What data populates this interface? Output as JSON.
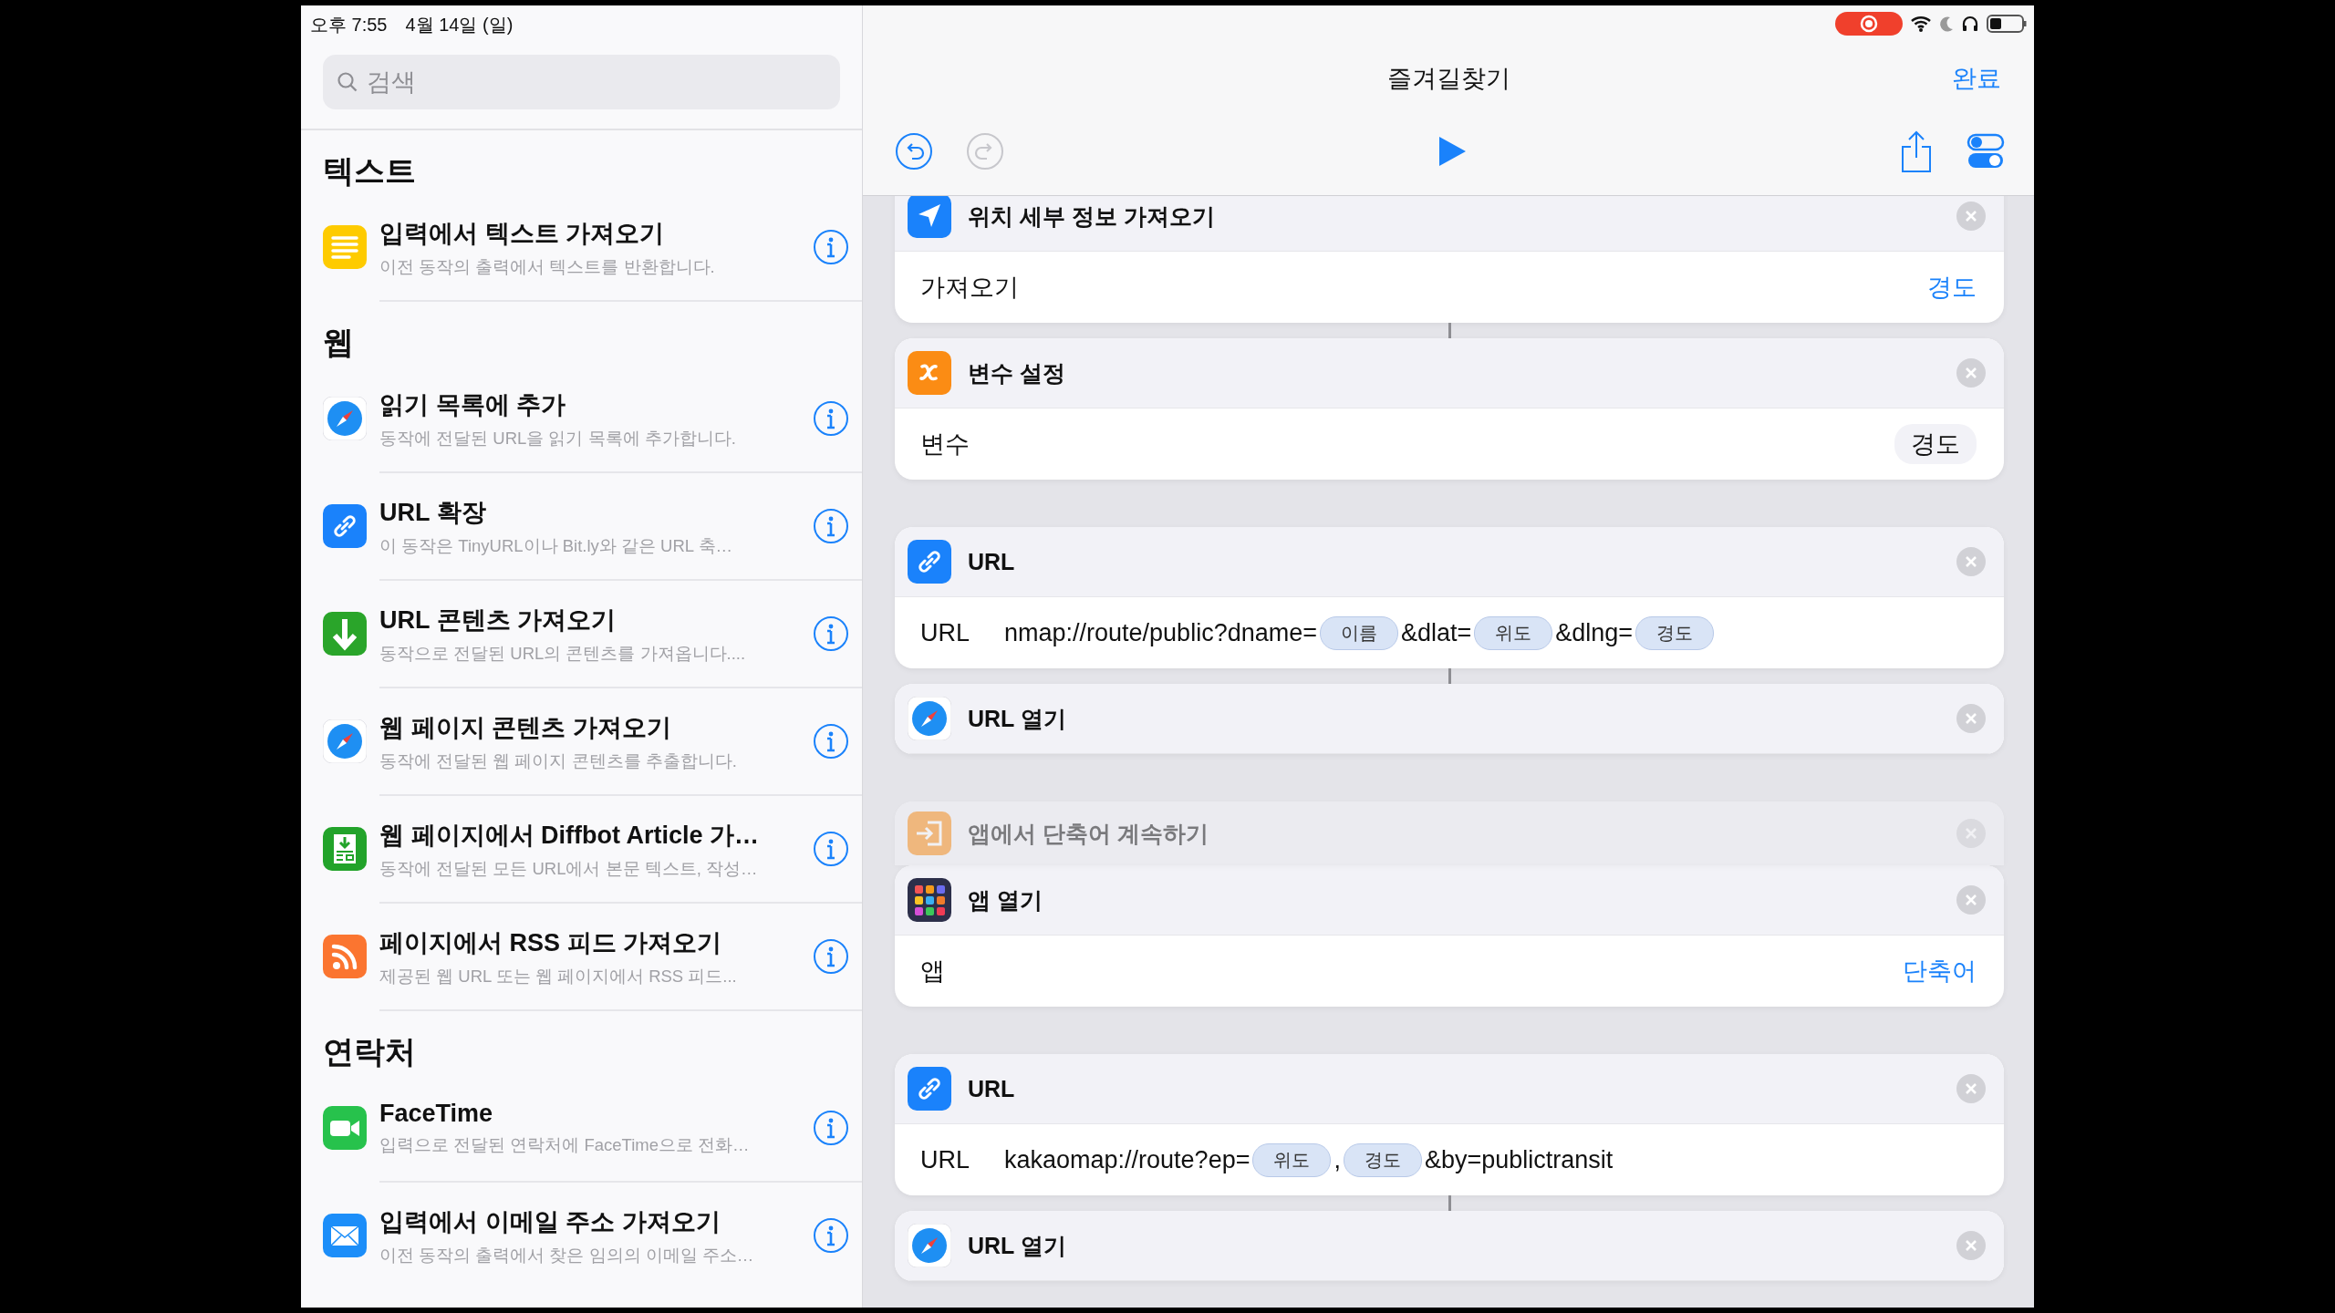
{
  "status_bar": {
    "time": "오후 7:55",
    "date": "4월 14일 (일)",
    "recording": true
  },
  "sidebar": {
    "search": {
      "placeholder": "검색"
    },
    "sections": [
      {
        "title": "텍스트",
        "items": [
          {
            "kind": "text",
            "title": "입력에서 텍스트 가져오기",
            "subtitle": "이전 동작의 출력에서 텍스트를 반환합니다."
          }
        ]
      },
      {
        "title": "웹",
        "items": [
          {
            "kind": "safari",
            "title": "읽기 목록에 추가",
            "subtitle": "동작에 전달된 URL을 읽기 목록에 추가합니다."
          },
          {
            "kind": "link",
            "title": "URL 확장",
            "subtitle": "이 동작은 TinyURL이나 Bit.ly와 같은 URL 축…"
          },
          {
            "kind": "download",
            "title": "URL 콘텐츠 가져오기",
            "subtitle": "동작으로 전달된 URL의 콘텐츠를 가져옵니다...."
          },
          {
            "kind": "safari",
            "title": "웹 페이지 콘텐츠 가져오기",
            "subtitle": "동작에 전달된 웹 페이지 콘텐츠를 추출합니다."
          },
          {
            "kind": "diffbot",
            "title": "웹 페이지에서 Diffbot Article 가…",
            "subtitle": "동작에 전달된 모든 URL에서 본문 텍스트, 작성…"
          },
          {
            "kind": "rss",
            "title": "페이지에서 RSS 피드 가져오기",
            "subtitle": "제공된 웹 URL 또는 웹 페이지에서 RSS 피드..."
          }
        ]
      },
      {
        "title": "연락처",
        "items": [
          {
            "kind": "facetime",
            "title": "FaceTime",
            "subtitle": "입력으로 전달된 연락처에 FaceTime으로 전화…"
          },
          {
            "kind": "mail",
            "title": "입력에서 이메일 주소 가져오기",
            "subtitle": "이전 동작의 출력에서 찾은 임의의 이메일 주소…"
          }
        ]
      }
    ]
  },
  "editor": {
    "title": "즐겨길찾기",
    "done": "완료",
    "groups": [
      {
        "actions": [
          {
            "kind": "location",
            "title": "위치 세부 정보 가져오기",
            "dimmed": false,
            "param": {
              "label": "가져오기",
              "kind": "link",
              "value": "경도"
            }
          },
          {
            "kind": "variable",
            "title": "변수 설정",
            "dimmed": false,
            "param": {
              "label": "변수",
              "kind": "pill",
              "value": "경도"
            }
          }
        ]
      },
      {
        "actions": [
          {
            "kind": "link",
            "title": "URL",
            "dimmed": false,
            "param": {
              "label": "URL",
              "kind": "url",
              "parts": [
                {
                  "kind": "text",
                  "text": "nmap://route/public?dname="
                },
                {
                  "kind": "token",
                  "text": "이름"
                },
                {
                  "kind": "text",
                  "text": "&dlat="
                },
                {
                  "kind": "token",
                  "text": "위도"
                },
                {
                  "kind": "text",
                  "text": "&dlng="
                },
                {
                  "kind": "token",
                  "text": "경도"
                }
              ]
            }
          },
          {
            "kind": "safari",
            "title": "URL 열기",
            "dimmed": false
          }
        ]
      },
      {
        "actions": [
          {
            "kind": "continue",
            "title": "앱에서 단축어 계속하기",
            "dimmed": true
          },
          {
            "kind": "apps",
            "title": "앱 열기",
            "dimmed": false,
            "param": {
              "label": "앱",
              "kind": "link",
              "value": "단축어"
            }
          }
        ]
      },
      {
        "actions": [
          {
            "kind": "link",
            "title": "URL",
            "dimmed": false,
            "param": {
              "label": "URL",
              "kind": "url",
              "parts": [
                {
                  "kind": "text",
                  "text": "kakaomap://route?ep="
                },
                {
                  "kind": "token",
                  "text": "위도"
                },
                {
                  "kind": "text",
                  "text": ","
                },
                {
                  "kind": "token",
                  "text": "경도"
                },
                {
                  "kind": "text",
                  "text": "&by=publictransit"
                }
              ]
            }
          },
          {
            "kind": "safari",
            "title": "URL 열기",
            "dimmed": false
          }
        ]
      }
    ]
  }
}
